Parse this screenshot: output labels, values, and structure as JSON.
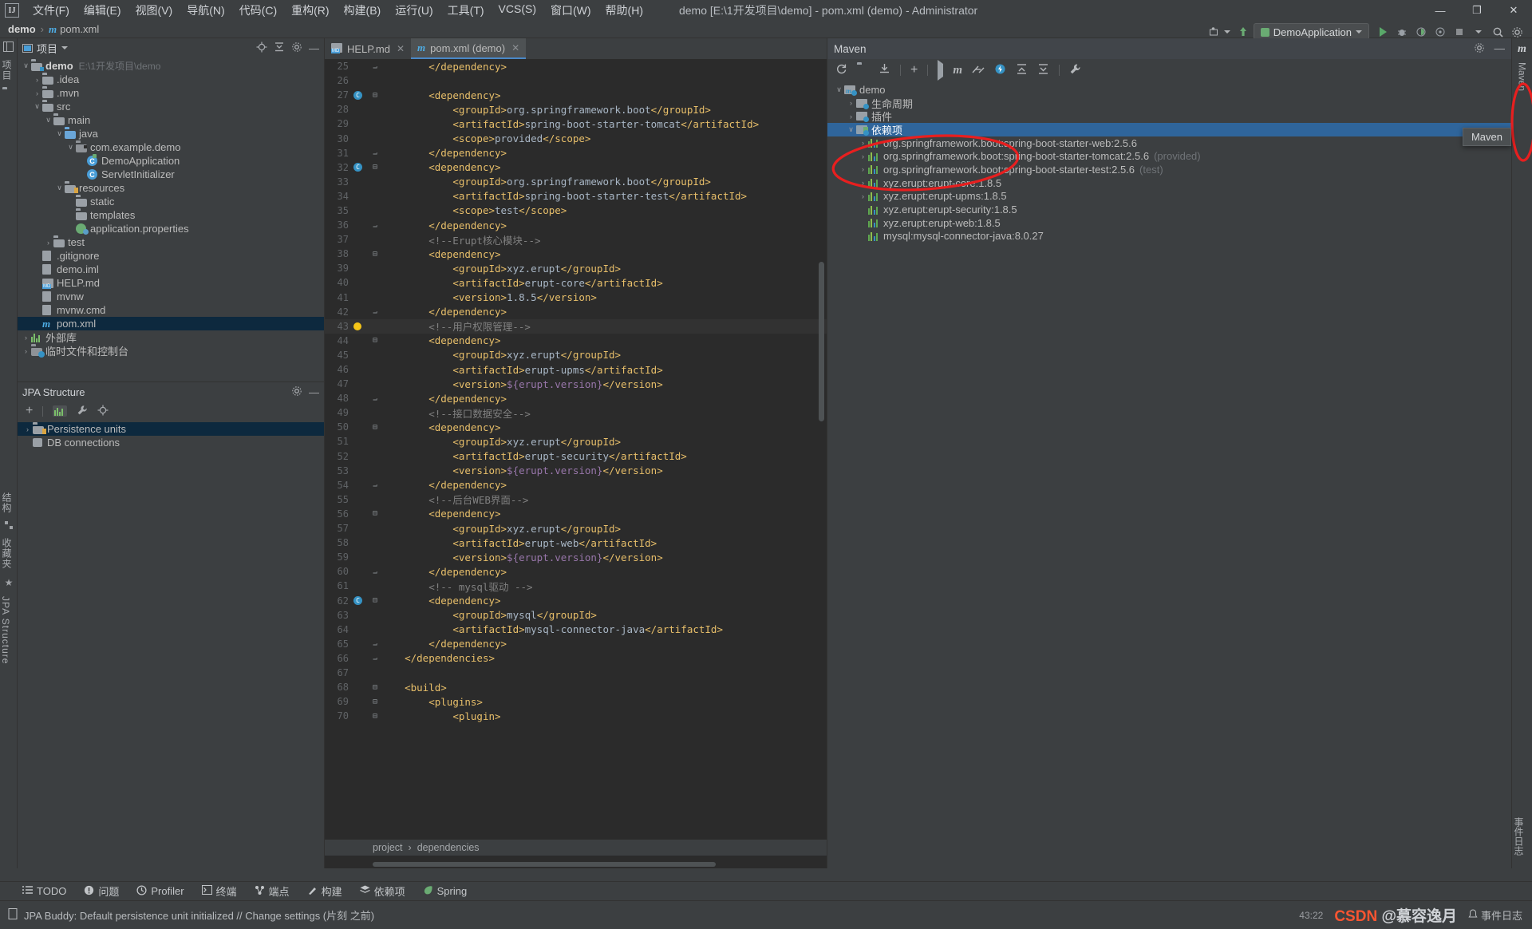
{
  "window": {
    "title": "demo [E:\\1开发项目\\demo] - pom.xml (demo) - Administrator",
    "logo": "IJ",
    "minimize": "—",
    "maximize": "❐",
    "close": "✕"
  },
  "menu": {
    "items": [
      {
        "label": "文件(F)"
      },
      {
        "label": "编辑(E)"
      },
      {
        "label": "视图(V)"
      },
      {
        "label": "导航(N)"
      },
      {
        "label": "代码(C)"
      },
      {
        "label": "重构(R)"
      },
      {
        "label": "构建(B)"
      },
      {
        "label": "运行(U)"
      },
      {
        "label": "工具(T)"
      },
      {
        "label": "VCS(S)"
      },
      {
        "label": "窗口(W)"
      },
      {
        "label": "帮助(H)"
      }
    ]
  },
  "navbar": {
    "project": "demo",
    "separator": "›",
    "file": "pom.xml",
    "file_icon": "maven-m-icon"
  },
  "toolbar": {
    "run_config": "DemoApplication",
    "buttons": [
      {
        "name": "search-everywhere-icon",
        "glyph": "⌕"
      },
      {
        "name": "settings-icon",
        "glyph": "⚙"
      },
      {
        "name": "project-widget-icon",
        "glyph": "☰"
      }
    ]
  },
  "left_stripe": {
    "top_labels": [
      "项目"
    ],
    "bottom_labels": [
      "结构",
      "收藏夹",
      "JPA Structure"
    ]
  },
  "project_panel": {
    "title": "项目",
    "tree": [
      {
        "indent": 0,
        "arrow": "∨",
        "icon": "module-folder",
        "label": "demo",
        "path": "E:\\1开发项目\\demo",
        "bold": true
      },
      {
        "indent": 1,
        "arrow": "›",
        "icon": "folder",
        "label": ".idea"
      },
      {
        "indent": 1,
        "arrow": "›",
        "icon": "folder",
        "label": ".mvn"
      },
      {
        "indent": 1,
        "arrow": "∨",
        "icon": "folder",
        "label": "src"
      },
      {
        "indent": 2,
        "arrow": "∨",
        "icon": "folder",
        "label": "main"
      },
      {
        "indent": 3,
        "arrow": "∨",
        "icon": "source-folder",
        "label": "java"
      },
      {
        "indent": 4,
        "arrow": "∨",
        "icon": "package",
        "label": "com.example.demo"
      },
      {
        "indent": 5,
        "arrow": "",
        "icon": "spring-class",
        "label": "DemoApplication"
      },
      {
        "indent": 5,
        "arrow": "",
        "icon": "class",
        "label": "ServletInitializer"
      },
      {
        "indent": 3,
        "arrow": "∨",
        "icon": "resource-folder",
        "label": "resources"
      },
      {
        "indent": 4,
        "arrow": "",
        "icon": "folder",
        "label": "static"
      },
      {
        "indent": 4,
        "arrow": "",
        "icon": "folder",
        "label": "templates"
      },
      {
        "indent": 4,
        "arrow": "",
        "icon": "spring-properties",
        "label": "application.properties"
      },
      {
        "indent": 2,
        "arrow": "›",
        "icon": "folder",
        "label": "test"
      },
      {
        "indent": 1,
        "arrow": "",
        "icon": "gitignore",
        "label": ".gitignore"
      },
      {
        "indent": 1,
        "arrow": "",
        "icon": "iml",
        "label": "demo.iml"
      },
      {
        "indent": 1,
        "arrow": "",
        "icon": "markdown",
        "label": "HELP.md"
      },
      {
        "indent": 1,
        "arrow": "",
        "icon": "script",
        "label": "mvnw"
      },
      {
        "indent": 1,
        "arrow": "",
        "icon": "cmd",
        "label": "mvnw.cmd"
      },
      {
        "indent": 1,
        "arrow": "",
        "icon": "maven-m-icon",
        "label": "pom.xml",
        "selected": true
      },
      {
        "indent": 0,
        "arrow": "›",
        "icon": "library",
        "label": "外部库"
      },
      {
        "indent": 0,
        "arrow": "›",
        "icon": "scratch",
        "label": "临时文件和控制台"
      }
    ]
  },
  "jpa_panel": {
    "title": "JPA Structure",
    "tree": [
      {
        "arrow": "›",
        "icon": "persistence-units-icon",
        "label": "Persistence units",
        "selected": true
      },
      {
        "arrow": "",
        "icon": "db-connections-icon",
        "label": "DB connections"
      }
    ]
  },
  "editor": {
    "tabs": [
      {
        "label": "HELP.md",
        "icon": "markdown-icon",
        "active": false
      },
      {
        "label": "pom.xml (demo)",
        "icon": "maven-m-icon",
        "active": true
      }
    ],
    "breadcrumb": [
      "project",
      "dependencies"
    ],
    "breadcrumb_sep": "›",
    "first_line": 25,
    "lines": [
      {
        "n": 25,
        "fold": "end",
        "code": "        </dependency>",
        "type": "tag"
      },
      {
        "n": 26,
        "code": ""
      },
      {
        "n": 27,
        "bean": true,
        "fold": "start",
        "code": "        <dependency>",
        "type": "tag"
      },
      {
        "n": 28,
        "code": "            <groupId>org.springframework.boot</groupId>"
      },
      {
        "n": 29,
        "code": "            <artifactId>spring-boot-starter-tomcat</artifactId>"
      },
      {
        "n": 30,
        "code": "            <scope>provided</scope>"
      },
      {
        "n": 31,
        "fold": "end",
        "code": "        </dependency>",
        "type": "tag"
      },
      {
        "n": 32,
        "bean": true,
        "fold": "start",
        "code": "        <dependency>",
        "type": "tag"
      },
      {
        "n": 33,
        "code": "            <groupId>org.springframework.boot</groupId>"
      },
      {
        "n": 34,
        "code": "            <artifactId>spring-boot-starter-test</artifactId>"
      },
      {
        "n": 35,
        "code": "            <scope>test</scope>"
      },
      {
        "n": 36,
        "fold": "end",
        "code": "        </dependency>",
        "type": "tag"
      },
      {
        "n": 37,
        "code": "        <!--Erupt核心模块-->",
        "type": "comment"
      },
      {
        "n": 38,
        "fold": "start",
        "code": "        <dependency>",
        "type": "tag"
      },
      {
        "n": 39,
        "code": "            <groupId>xyz.erupt</groupId>"
      },
      {
        "n": 40,
        "code": "            <artifactId>erupt-core</artifactId>"
      },
      {
        "n": 41,
        "code": "            <version>1.8.5</version>"
      },
      {
        "n": 42,
        "fold": "end",
        "code": "        </dependency>",
        "type": "tag"
      },
      {
        "n": 43,
        "bulb": true,
        "highlight": true,
        "code": "        <!--用户权限管理-->",
        "type": "comment"
      },
      {
        "n": 44,
        "fold": "start",
        "code": "        <dependency>",
        "type": "tag"
      },
      {
        "n": 45,
        "code": "            <groupId>xyz.erupt</groupId>"
      },
      {
        "n": 46,
        "code": "            <artifactId>erupt-upms</artifactId>"
      },
      {
        "n": 47,
        "code": "            <version>${erupt.version}</version>",
        "type": "var"
      },
      {
        "n": 48,
        "fold": "end",
        "code": "        </dependency>",
        "type": "tag"
      },
      {
        "n": 49,
        "code": "        <!--接口数据安全-->",
        "type": "comment"
      },
      {
        "n": 50,
        "fold": "start",
        "code": "        <dependency>",
        "type": "tag"
      },
      {
        "n": 51,
        "code": "            <groupId>xyz.erupt</groupId>"
      },
      {
        "n": 52,
        "code": "            <artifactId>erupt-security</artifactId>"
      },
      {
        "n": 53,
        "code": "            <version>${erupt.version}</version>",
        "type": "var"
      },
      {
        "n": 54,
        "fold": "end",
        "code": "        </dependency>",
        "type": "tag"
      },
      {
        "n": 55,
        "code": "        <!--后台WEB界面-->",
        "type": "comment"
      },
      {
        "n": 56,
        "fold": "start",
        "code": "        <dependency>",
        "type": "tag"
      },
      {
        "n": 57,
        "code": "            <groupId>xyz.erupt</groupId>"
      },
      {
        "n": 58,
        "code": "            <artifactId>erupt-web</artifactId>"
      },
      {
        "n": 59,
        "code": "            <version>${erupt.version}</version>",
        "type": "var"
      },
      {
        "n": 60,
        "fold": "end",
        "code": "        </dependency>",
        "type": "tag"
      },
      {
        "n": 61,
        "code": "        <!-- mysql驱动 -->",
        "type": "comment"
      },
      {
        "n": 62,
        "bean": true,
        "fold": "start",
        "code": "        <dependency>",
        "type": "tag"
      },
      {
        "n": 63,
        "code": "            <groupId>mysql</groupId>"
      },
      {
        "n": 64,
        "code": "            <artifactId>mysql-connector-java</artifactId>"
      },
      {
        "n": 65,
        "fold": "end",
        "code": "        </dependency>",
        "type": "tag"
      },
      {
        "n": 66,
        "fold": "end",
        "code": "    </dependencies>",
        "type": "tag"
      },
      {
        "n": 67,
        "code": ""
      },
      {
        "n": 68,
        "fold": "start",
        "code": "    <build>",
        "type": "tag"
      },
      {
        "n": 69,
        "fold": "start",
        "code": "        <plugins>",
        "type": "tag"
      },
      {
        "n": 70,
        "fold": "start",
        "code": "            <plugin>",
        "type": "tag"
      }
    ]
  },
  "maven_panel": {
    "title": "Maven",
    "tree": [
      {
        "indent": 0,
        "arrow": "∨",
        "icon": "maven-project-icon",
        "label": "demo"
      },
      {
        "indent": 1,
        "arrow": "›",
        "icon": "lifecycle-folder-icon",
        "label": "生命周期"
      },
      {
        "indent": 1,
        "arrow": "›",
        "icon": "plugins-folder-icon",
        "label": "插件"
      },
      {
        "indent": 1,
        "arrow": "∨",
        "icon": "dependencies-folder-icon",
        "label": "依赖项",
        "selected": true
      },
      {
        "indent": 2,
        "arrow": "›",
        "icon": "dependency-icon",
        "label": "org.springframework.boot:spring-boot-starter-web:2.5.6"
      },
      {
        "indent": 2,
        "arrow": "›",
        "icon": "dependency-icon",
        "label": "org.springframework.boot:spring-boot-starter-tomcat:2.5.6",
        "scope": "(provided)"
      },
      {
        "indent": 2,
        "arrow": "›",
        "icon": "dependency-icon",
        "label": "org.springframework.boot:spring-boot-starter-test:2.5.6",
        "scope": "(test)"
      },
      {
        "indent": 2,
        "arrow": "›",
        "icon": "dependency-icon",
        "label": "xyz.erupt:erupt-core:1.8.5"
      },
      {
        "indent": 2,
        "arrow": "›",
        "icon": "dependency-icon",
        "label": "xyz.erupt:erupt-upms:1.8.5"
      },
      {
        "indent": 2,
        "arrow": "",
        "icon": "dependency-icon",
        "label": "xyz.erupt:erupt-security:1.8.5"
      },
      {
        "indent": 2,
        "arrow": "",
        "icon": "dependency-icon",
        "label": "xyz.erupt:erupt-web:1.8.5"
      },
      {
        "indent": 2,
        "arrow": "",
        "icon": "dependency-icon",
        "label": "mysql:mysql-connector-java:8.0.27"
      }
    ]
  },
  "right_stripe": {
    "label": "Maven",
    "tooltip": "Maven",
    "bottom_label": "事件日志"
  },
  "bottom_bar": {
    "items": [
      {
        "label": "TODO",
        "icon": "todo-icon"
      },
      {
        "label": "问题",
        "icon": "problems-icon"
      },
      {
        "label": "Profiler",
        "icon": "profiler-icon"
      },
      {
        "label": "终端",
        "icon": "terminal-icon"
      },
      {
        "label": "端点",
        "icon": "endpoints-icon"
      },
      {
        "label": "构建",
        "icon": "build-icon"
      },
      {
        "label": "依赖项",
        "icon": "dependencies-icon"
      },
      {
        "label": "Spring",
        "icon": "spring-icon"
      }
    ]
  },
  "status_bar": {
    "message": "JPA Buddy: Default persistence unit initialized // Change settings (片刻 之前)",
    "caret_position": "43:22",
    "event_log": "事件日志",
    "watermark_prefix": "CSDN ",
    "watermark_suffix": "@慕容逸月"
  },
  "colors": {
    "accent": "#3592c4",
    "selection": "#2f659b",
    "tree_selection": "#0d293e",
    "annotation": "#e81f1f",
    "editor_bg": "#2b2b2b",
    "panel_bg": "#3c3f41",
    "tag": "#e8bf6a",
    "comment": "#808080",
    "text": "#a9b7c6"
  }
}
